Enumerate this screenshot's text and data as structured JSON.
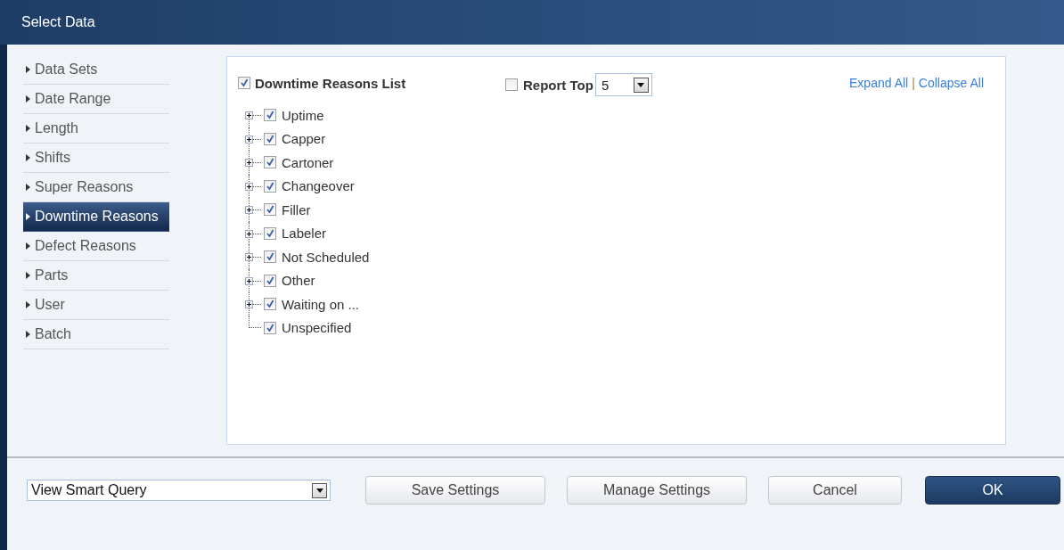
{
  "window": {
    "title": "Select Data"
  },
  "sidebar": {
    "items": [
      {
        "label": "Data Sets",
        "selected": false
      },
      {
        "label": "Date Range",
        "selected": false
      },
      {
        "label": "Length",
        "selected": false
      },
      {
        "label": "Shifts",
        "selected": false
      },
      {
        "label": "Super Reasons",
        "selected": false
      },
      {
        "label": "Downtime Reasons",
        "selected": true
      },
      {
        "label": "Defect Reasons",
        "selected": false
      },
      {
        "label": "Parts",
        "selected": false
      },
      {
        "label": "User",
        "selected": false
      },
      {
        "label": "Batch",
        "selected": false
      }
    ]
  },
  "list_header": {
    "label": "Downtime Reasons List",
    "checked": true
  },
  "report_top": {
    "label": "Report Top",
    "checked": false,
    "value": "5"
  },
  "links": {
    "expand": "Expand All",
    "separator": "|",
    "collapse": "Collapse All"
  },
  "tree": [
    {
      "label": "Uptime",
      "checked": true,
      "expandable": true
    },
    {
      "label": "Capper",
      "checked": true,
      "expandable": true
    },
    {
      "label": "Cartoner",
      "checked": true,
      "expandable": true
    },
    {
      "label": "Changeover",
      "checked": true,
      "expandable": true
    },
    {
      "label": "Filler",
      "checked": true,
      "expandable": true
    },
    {
      "label": "Labeler",
      "checked": true,
      "expandable": true
    },
    {
      "label": "Not Scheduled",
      "checked": true,
      "expandable": true
    },
    {
      "label": "Other",
      "checked": true,
      "expandable": true
    },
    {
      "label": "Waiting on ...",
      "checked": true,
      "expandable": true
    },
    {
      "label": "Unspecified",
      "checked": true,
      "expandable": false
    }
  ],
  "footer": {
    "query": "View Smart Query",
    "buttons": [
      {
        "label": "Save Settings",
        "kind": "normal"
      },
      {
        "label": "Manage Settings",
        "kind": "normal"
      },
      {
        "label": "Cancel",
        "kind": "normal"
      },
      {
        "label": "OK",
        "kind": "primary"
      }
    ]
  }
}
